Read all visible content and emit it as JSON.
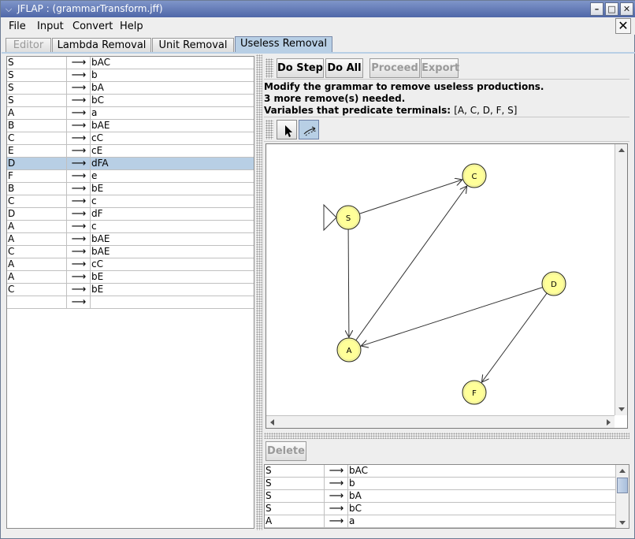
{
  "window": {
    "title": "JFLAP : (grammarTransform.jff)",
    "system_menu_glyph": "⌵",
    "minimize_glyph": "–",
    "maximize_glyph": "□",
    "close_glyph": "✕"
  },
  "menubar": {
    "items": [
      "File",
      "Input",
      "Convert",
      "Help"
    ],
    "close_doc_glyph": "✕"
  },
  "tabs": [
    {
      "label": "Editor",
      "state": "disabled"
    },
    {
      "label": "Lambda Removal",
      "state": "normal"
    },
    {
      "label": "Unit Removal",
      "state": "normal"
    },
    {
      "label": "Useless Removal",
      "state": "active"
    }
  ],
  "grammar": {
    "arrow": "⟶",
    "selected_index": 8,
    "rows": [
      {
        "lhs": "S",
        "rhs": "bAC"
      },
      {
        "lhs": "S",
        "rhs": "b"
      },
      {
        "lhs": "S",
        "rhs": "bA"
      },
      {
        "lhs": "S",
        "rhs": "bC"
      },
      {
        "lhs": "A",
        "rhs": "a"
      },
      {
        "lhs": "B",
        "rhs": "bAE"
      },
      {
        "lhs": "C",
        "rhs": "cC"
      },
      {
        "lhs": "E",
        "rhs": "cE"
      },
      {
        "lhs": "D",
        "rhs": "dFA"
      },
      {
        "lhs": "F",
        "rhs": "e"
      },
      {
        "lhs": "B",
        "rhs": "bE"
      },
      {
        "lhs": "C",
        "rhs": "c"
      },
      {
        "lhs": "D",
        "rhs": "dF"
      },
      {
        "lhs": "A",
        "rhs": "c"
      },
      {
        "lhs": "A",
        "rhs": "bAE"
      },
      {
        "lhs": "C",
        "rhs": "bAE"
      },
      {
        "lhs": "A",
        "rhs": "cC"
      },
      {
        "lhs": "A",
        "rhs": "bE"
      },
      {
        "lhs": "C",
        "rhs": "bE"
      },
      {
        "lhs": "",
        "rhs": ""
      }
    ]
  },
  "toolbar": {
    "do_step": "Do Step",
    "do_all": "Do All",
    "proceed": "Proceed",
    "export": "Export"
  },
  "messages": {
    "line1": "Modify the grammar to remove useless productions.",
    "line2": "3 more remove(s) needed.",
    "line3_label": "Variables that predicate terminals:",
    "line3_value": "[A, C, D, F, S]"
  },
  "graph": {
    "initial_state": "S",
    "node_fill": "#ffff99",
    "nodes": [
      {
        "id": "S",
        "label": "S"
      },
      {
        "id": "C",
        "label": "C"
      },
      {
        "id": "D",
        "label": "D"
      },
      {
        "id": "A",
        "label": "A"
      },
      {
        "id": "F",
        "label": "F"
      }
    ],
    "edges": [
      {
        "from": "S",
        "to": "C"
      },
      {
        "from": "S",
        "to": "A"
      },
      {
        "from": "A",
        "to": "C"
      },
      {
        "from": "D",
        "to": "A"
      },
      {
        "from": "D",
        "to": "F"
      }
    ]
  },
  "bottom": {
    "delete_label": "Delete",
    "rows": [
      {
        "lhs": "S",
        "rhs": "bAC"
      },
      {
        "lhs": "S",
        "rhs": "b"
      },
      {
        "lhs": "S",
        "rhs": "bA"
      },
      {
        "lhs": "S",
        "rhs": "bC"
      },
      {
        "lhs": "A",
        "rhs": "a"
      }
    ]
  },
  "colors": {
    "accent": "#b8cfe5",
    "title_bar": "#4f67a8"
  }
}
